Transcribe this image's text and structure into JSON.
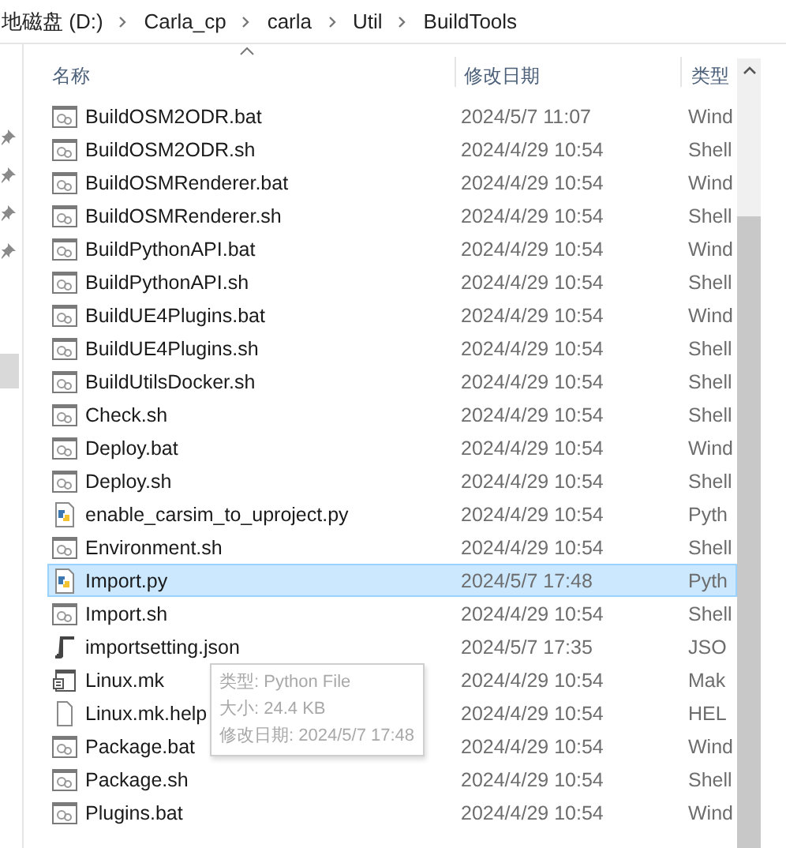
{
  "breadcrumb": [
    "地磁盘 (D:)",
    "Carla_cp",
    "carla",
    "Util",
    "BuildTools"
  ],
  "nav": {
    "selected_item": true
  },
  "columns": [
    {
      "label": "名称"
    },
    {
      "label": "修改日期"
    },
    {
      "label": "类型"
    }
  ],
  "rows": [
    {
      "name": "BuildOSM2ODR.bat",
      "modified": "2024/5/7 11:07",
      "type": "Wind",
      "kind": "script",
      "selected": false
    },
    {
      "name": "BuildOSM2ODR.sh",
      "modified": "2024/4/29 10:54",
      "type": "Shell",
      "kind": "script",
      "selected": false
    },
    {
      "name": "BuildOSMRenderer.bat",
      "modified": "2024/4/29 10:54",
      "type": "Wind",
      "kind": "script",
      "selected": false
    },
    {
      "name": "BuildOSMRenderer.sh",
      "modified": "2024/4/29 10:54",
      "type": "Shell",
      "kind": "script",
      "selected": false
    },
    {
      "name": "BuildPythonAPI.bat",
      "modified": "2024/4/29 10:54",
      "type": "Wind",
      "kind": "script",
      "selected": false
    },
    {
      "name": "BuildPythonAPI.sh",
      "modified": "2024/4/29 10:54",
      "type": "Shell",
      "kind": "script",
      "selected": false
    },
    {
      "name": "BuildUE4Plugins.bat",
      "modified": "2024/4/29 10:54",
      "type": "Wind",
      "kind": "script",
      "selected": false
    },
    {
      "name": "BuildUE4Plugins.sh",
      "modified": "2024/4/29 10:54",
      "type": "Shell",
      "kind": "script",
      "selected": false
    },
    {
      "name": "BuildUtilsDocker.sh",
      "modified": "2024/4/29 10:54",
      "type": "Shell",
      "kind": "script",
      "selected": false
    },
    {
      "name": "Check.sh",
      "modified": "2024/4/29 10:54",
      "type": "Shell",
      "kind": "script",
      "selected": false
    },
    {
      "name": "Deploy.bat",
      "modified": "2024/4/29 10:54",
      "type": "Wind",
      "kind": "script",
      "selected": false
    },
    {
      "name": "Deploy.sh",
      "modified": "2024/4/29 10:54",
      "type": "Shell",
      "kind": "script",
      "selected": false
    },
    {
      "name": "enable_carsim_to_uproject.py",
      "modified": "2024/4/29 10:54",
      "type": "Pyth",
      "kind": "python",
      "selected": false
    },
    {
      "name": "Environment.sh",
      "modified": "2024/4/29 10:54",
      "type": "Shell",
      "kind": "script",
      "selected": false
    },
    {
      "name": "Import.py",
      "modified": "2024/5/7 17:48",
      "type": "Pyth",
      "kind": "python",
      "selected": true
    },
    {
      "name": "Import.sh",
      "modified": "2024/4/29 10:54",
      "type": "Shell",
      "kind": "script",
      "selected": false
    },
    {
      "name": "importsetting.json",
      "modified": "2024/5/7 17:35",
      "type": "JSO",
      "kind": "json",
      "selected": false
    },
    {
      "name": "Linux.mk",
      "modified": "2024/4/29 10:54",
      "type": "Mak",
      "kind": "make",
      "selected": false
    },
    {
      "name": "Linux.mk.help",
      "modified": "2024/4/29 10:54",
      "type": "HEL",
      "kind": "blank",
      "selected": false
    },
    {
      "name": "Package.bat",
      "modified": "2024/4/29 10:54",
      "type": "Wind",
      "kind": "script",
      "selected": false
    },
    {
      "name": "Package.sh",
      "modified": "2024/4/29 10:54",
      "type": "Shell",
      "kind": "script",
      "selected": false
    },
    {
      "name": "Plugins.bat",
      "modified": "2024/4/29 10:54",
      "type": "Wind",
      "kind": "script",
      "selected": false
    }
  ],
  "tooltip": [
    "类型: Python File",
    "大小: 24.4 KB",
    "修改日期: 2024/5/7 17:48"
  ]
}
